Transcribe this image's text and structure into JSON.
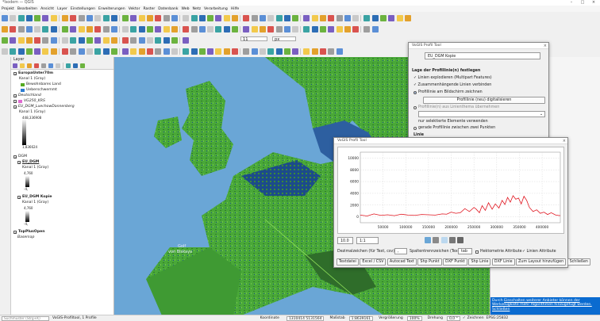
{
  "window": {
    "title": "*Isodem — QGIS",
    "min": "–",
    "max": "□",
    "close": "×"
  },
  "menu": [
    "Projekt",
    "Bearbeiten",
    "Ansicht",
    "Layer",
    "Einstellungen",
    "Erweiterungen",
    "Vektor",
    "Raster",
    "Datenbank",
    "Web",
    "Netz",
    "Verarbeitung",
    "Hilfe"
  ],
  "style_toolbar": {
    "font_size": "11",
    "unit": "px"
  },
  "layers_panel": {
    "title": "Layer"
  },
  "layers": [
    {
      "label": "EuropaUnter70m",
      "bold": true,
      "checked": true
    },
    {
      "label": "Kanal 1 (Gray)"
    },
    {
      "label": "Bewohnbares Land",
      "swatch": "#55aa22"
    },
    {
      "label": "Ueberschwemmt",
      "swatch": "#2b7bd1"
    },
    {
      "label": "Deutschland",
      "italic": true,
      "checked": true
    },
    {
      "label": "VG250_KRS",
      "italic": true,
      "swatch": "#e06ad1",
      "checked": true
    },
    {
      "label": "EU_DGM_LuechowDannenberg",
      "italic": true,
      "checked": true
    },
    {
      "label": "Kanal 1 (Gray)"
    },
    {
      "label": "448,336908",
      "small": true
    },
    {
      "label": "1,836624",
      "small": true
    },
    {
      "label": "DGM",
      "checked": true
    },
    {
      "label": "EU_DGM",
      "bold": true,
      "underline": true,
      "checked": true
    },
    {
      "label": "Kanal 1 (Gray)"
    },
    {
      "label": "4,760",
      "small": true
    },
    {
      "label": "-4,",
      "small": true
    },
    {
      "label": "EU_DGM Kopie",
      "bold": true,
      "checked": true
    },
    {
      "label": "Kanal 1 (Gray)"
    },
    {
      "label": "4,760",
      "small": true
    },
    {
      "label": "-4,",
      "small": true
    },
    {
      "label": "TopPlusOpen",
      "bold": true,
      "checked": true
    },
    {
      "label": "Basemap",
      "italic": true
    }
  ],
  "map": {
    "label_golf": "Golf",
    "label_golf2": "von Biskaya"
  },
  "vogis_dialog": {
    "title": "VoGIS Profil Tool",
    "layer_field": "EU_DGM Kopie",
    "section_heading": "Lage der Profillinie(n) festlegen",
    "check_explode": "Linien explodieren (Multipart Features)",
    "check_merge": "Zusammenhängende Linien verbinden",
    "radio_draw": "Profillinie am Bildschirm zeichnen",
    "btn_digitize": "Profillinie (neu) digitalisieren",
    "radio_layer": "Profillinie(n) aus Linienthema übernehmen",
    "check_selected": "nur selektierte Elemente verwenden",
    "radio_points": "gerade Profillinie zwischen zwei Punkten",
    "section_line": "Linie"
  },
  "profile_dialog": {
    "title": "VoGIS Profil Tool",
    "scale_value": "10.0",
    "ratio_value": "1:1",
    "decimal_label": "Dezimalzeichen (für Text, csv):",
    "decimal_value": ",",
    "column_sep_label": "Spaltentrennzeichen (Text):",
    "column_sep_value": "tab",
    "hekto_label": "Hektometrie Attribute",
    "line_attr_label": "Linien Attribute",
    "buttons": [
      "Textdatei",
      "Excel / CSV",
      "Autocad Text",
      "Shp Punkt",
      "DXF Punkt",
      "Shp Linie",
      "DXF Linie",
      "Zum Layout hinzufügen",
      "Schließen"
    ]
  },
  "notification": {
    "prefix": "Durch",
    "link1": "Einschalten weiterer Anbieter können der Werkzeugkiste mehr Algorithmen hinzugefügt werden.",
    "link2": "Schließen"
  },
  "statusbar": {
    "search_placeholder": "Suchmuster (Strg+K)",
    "message": "VoGIS-Profiltool, 1 Profile",
    "coord_label": "Koordinate",
    "coord_value": "1310414 5131564",
    "scale_label": "Maßstab",
    "scale_value": "1:8639161",
    "magnify_label": "Vergrößerung",
    "magnify_value": "100%",
    "rotation_label": "Drehung",
    "rotation_value": "0,0 °",
    "render_label": "Zeichnen",
    "crs": "EPSG:25832"
  },
  "chart_data": {
    "type": "line",
    "x_ticks": [
      50000,
      100000,
      150000,
      200000,
      250000,
      300000,
      350000,
      400000
    ],
    "y_ticks": [
      0,
      2000,
      4000,
      6000,
      8000,
      10000
    ],
    "xlim": [
      0,
      440000
    ],
    "ylim": [
      -1000,
      11000
    ],
    "color": "#e0141e",
    "grid": true,
    "x": [
      0,
      15000,
      30000,
      45000,
      60000,
      75000,
      90000,
      105000,
      120000,
      135000,
      150000,
      165000,
      180000,
      190000,
      200000,
      210000,
      220000,
      230000,
      240000,
      250000,
      255000,
      262000,
      268000,
      275000,
      282000,
      290000,
      297000,
      305000,
      312000,
      318000,
      324000,
      330000,
      336000,
      342000,
      348000,
      354000,
      360000,
      366000,
      372000,
      380000,
      388000,
      396000,
      404000,
      412000,
      420000,
      430000,
      440000
    ],
    "y": [
      300,
      150,
      500,
      250,
      350,
      200,
      450,
      300,
      250,
      400,
      350,
      300,
      500,
      450,
      800,
      600,
      700,
      1400,
      900,
      1600,
      1300,
      700,
      1900,
      1100,
      2400,
      1300,
      2200,
      1500,
      2800,
      2100,
      3300,
      2500,
      3600,
      3000,
      3200,
      2200,
      3500,
      2800,
      1600,
      900,
      1200,
      600,
      800,
      400,
      700,
      300,
      200
    ]
  }
}
